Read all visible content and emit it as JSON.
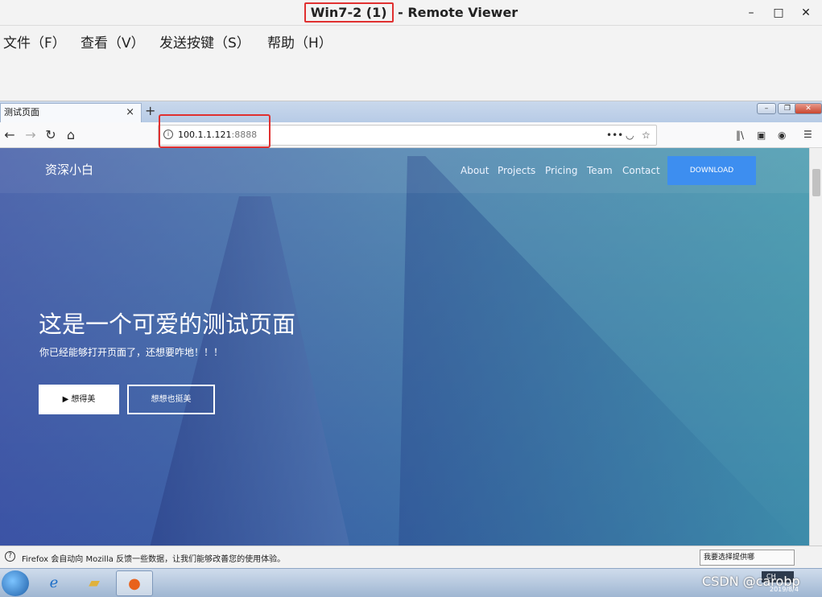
{
  "viewer": {
    "title_highlight": "Win7-2 (1)",
    "title_rest": " - Remote Viewer",
    "menus": [
      "文件（F）",
      "查看（V）",
      "发送按键（S）",
      "帮助（H）"
    ],
    "minimize": "–",
    "maximize": "□",
    "close": "✕"
  },
  "browser": {
    "tab_title": "测试页面",
    "tab_close": "×",
    "new_tab": "+",
    "url_host": "100.1.1.121",
    "url_port": ":8888",
    "more_actions": "•••",
    "menu": "☰"
  },
  "site": {
    "brand": "资深小白",
    "nav": [
      "About",
      "Projects",
      "Pricing",
      "Team",
      "Contact"
    ],
    "download": "DOWNLOAD",
    "hero_title": "这是一个可爱的测试页面",
    "hero_subtitle": "你已经能够打开页面了，还想要咋地！！！",
    "btn_primary": "▶ 想得美",
    "btn_outline": "想想也挺美"
  },
  "notification": {
    "message": "Firefox 会自动向 Mozilla 反馈一些数据，让我们能够改善您的使用体验。",
    "choose": "我要选择提供哪"
  },
  "taskbar": {
    "lang": "CH",
    "watermark": "CSDN @carobp",
    "date": "2019/8/4"
  }
}
